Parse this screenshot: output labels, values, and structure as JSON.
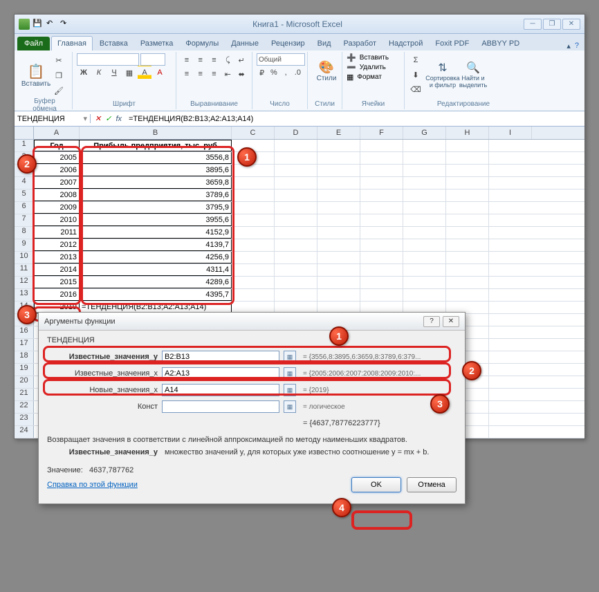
{
  "window": {
    "title": "Книга1 - Microsoft Excel"
  },
  "tabs": {
    "file": "Файл",
    "items": [
      "Главная",
      "Вставка",
      "Разметка",
      "Формулы",
      "Данные",
      "Рецензир",
      "Вид",
      "Разработ",
      "Надстрой",
      "Foxit PDF",
      "ABBYY PD"
    ],
    "active": 0
  },
  "ribbon": {
    "clipboard_label": "Буфер обмена",
    "paste": "Вставить",
    "font_label": "Шрифт",
    "bold": "Ж",
    "italic": "К",
    "underline": "Ч",
    "align_label": "Выравнивание",
    "number_label": "Число",
    "number_format": "Общий",
    "styles_label": "Стили",
    "styles": "Стили",
    "cells_label": "Ячейки",
    "insert": "Вставить",
    "delete": "Удалить",
    "format": "Формат",
    "editing_label": "Редактирование",
    "sort": "Сортировка и фильтр",
    "find": "Найти и выделить",
    "sigma": "Σ"
  },
  "formula_bar": {
    "name": "ТЕНДЕНЦИЯ",
    "fx": "fx",
    "formula": "=ТЕНДЕНЦИЯ(B2:B13;A2:A13;A14)"
  },
  "columns": [
    "A",
    "B",
    "C",
    "D",
    "E",
    "F",
    "G",
    "H",
    "I"
  ],
  "table": {
    "headers": {
      "a": "Год",
      "b": "Прибыль предприятия, тыс. руб"
    },
    "rows": [
      {
        "r": 2,
        "a": "2005",
        "b": "3556,8"
      },
      {
        "r": 3,
        "a": "2006",
        "b": "3895,6"
      },
      {
        "r": 4,
        "a": "2007",
        "b": "3659,8"
      },
      {
        "r": 5,
        "a": "2008",
        "b": "3789,6"
      },
      {
        "r": 6,
        "a": "2009",
        "b": "3795,9"
      },
      {
        "r": 7,
        "a": "2010",
        "b": "3955,6"
      },
      {
        "r": 8,
        "a": "2011",
        "b": "4152,9"
      },
      {
        "r": 9,
        "a": "2012",
        "b": "4139,7"
      },
      {
        "r": 10,
        "a": "2013",
        "b": "4256,9"
      },
      {
        "r": 11,
        "a": "2014",
        "b": "4311,4"
      },
      {
        "r": 12,
        "a": "2015",
        "b": "4289,6"
      },
      {
        "r": 13,
        "a": "2016",
        "b": "4395,7"
      }
    ],
    "input_row": {
      "r": 14,
      "a": "2019",
      "b": "=ТЕНДЕНЦИЯ(B2:B13;A2:A13;A14)"
    }
  },
  "dialog": {
    "title": "Аргументы функции",
    "func": "ТЕНДЕНЦИЯ",
    "args": [
      {
        "label": "Известные_значения_y",
        "value": "B2:B13",
        "result": "= {3556,8:3895,6:3659,8:3789,6:379..."
      },
      {
        "label": "Известные_значения_x",
        "value": "A2:A13",
        "result": "= {2005:2006:2007:2008:2009:2010:..."
      },
      {
        "label": "Новые_значения_x",
        "value": "A14",
        "result": "= {2019}"
      },
      {
        "label": "Конст",
        "value": "",
        "result": "= логическое"
      }
    ],
    "calc_result": "= {4637,78776223777}",
    "description": "Возвращает значения в соответствии с линейной аппроксимацией по методу наименьших квадратов.",
    "arg_desc_name": "Известные_значения_y",
    "arg_desc_text": "множество значений y, для которых уже известно соотношение y = mx + b.",
    "value_label": "Значение:",
    "value": "4637,787762",
    "help": "Справка по этой функции",
    "ok": "OK",
    "cancel": "Отмена"
  },
  "badges": {
    "b1": "1",
    "b2": "2",
    "b3": "3",
    "b4": "4"
  }
}
